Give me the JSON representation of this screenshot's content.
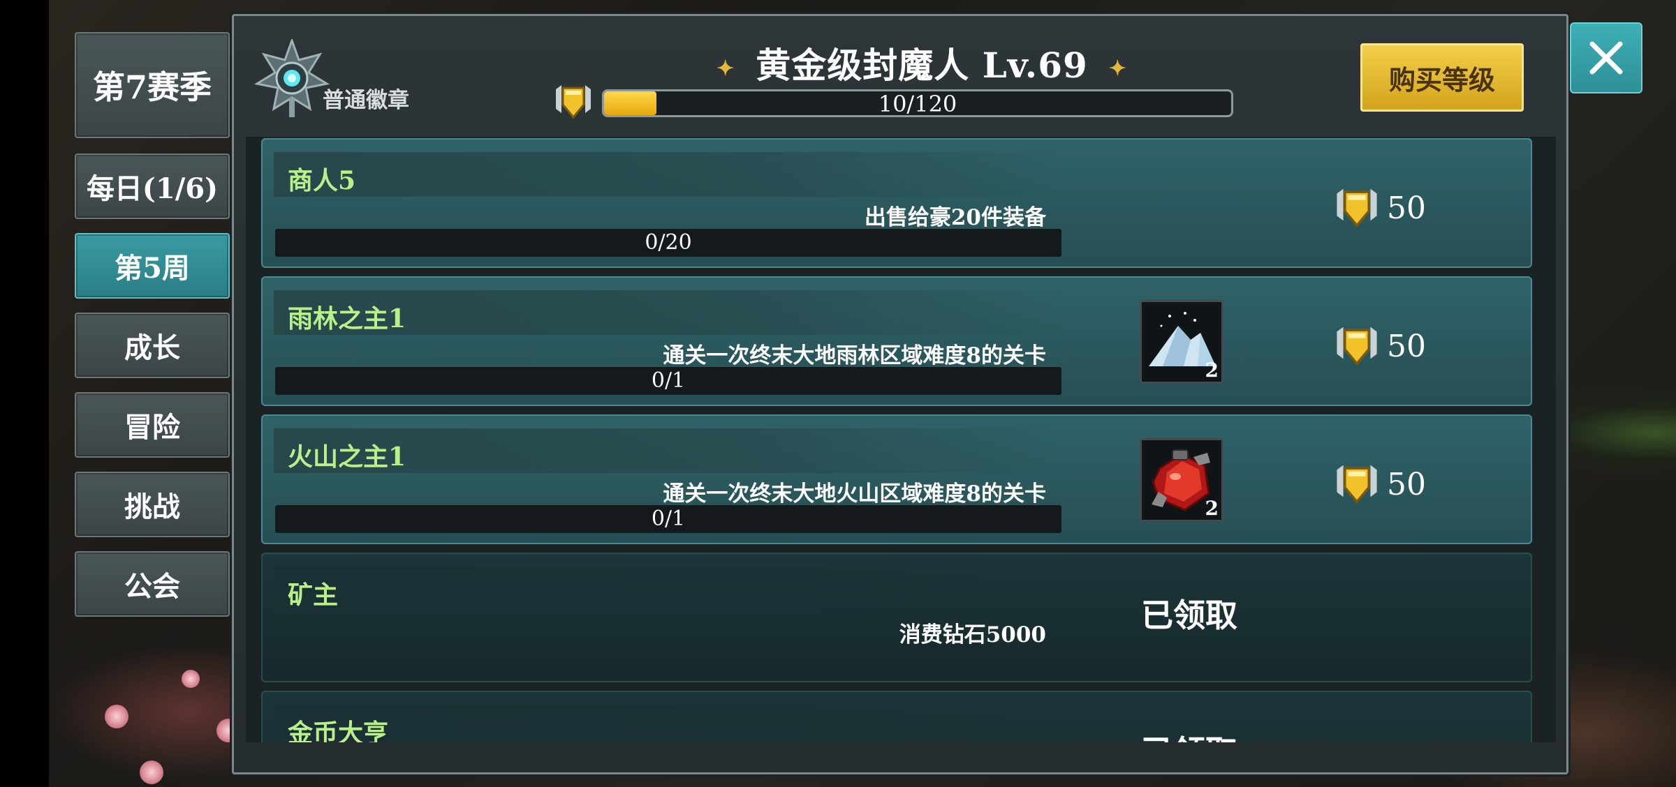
{
  "tabs": [
    {
      "label": "第7赛季",
      "active": false
    },
    {
      "label": "每日(1/6)",
      "active": false
    },
    {
      "label": "第5周",
      "active": true
    },
    {
      "label": "成长",
      "active": false
    },
    {
      "label": "冒险",
      "active": false
    },
    {
      "label": "挑战",
      "active": false
    },
    {
      "label": "公会",
      "active": false
    }
  ],
  "header": {
    "badge_label": "普通徽章",
    "level_title": "黄金级封魔人 Lv.69",
    "xp_text": "10/120",
    "xp_fraction": 0.083,
    "buy_label": "购买等级"
  },
  "tasks": [
    {
      "name": "商人5",
      "desc": "出售给豪20件装备",
      "progress": "0/20",
      "reward": "50",
      "item": null,
      "claimed": false
    },
    {
      "name": "雨林之主1",
      "desc": "通关一次终末大地雨林区域难度8的关卡",
      "progress": "0/1",
      "reward": "50",
      "item": {
        "icon": "crystal-pile-icon",
        "count": "2"
      },
      "claimed": false
    },
    {
      "name": "火山之主1",
      "desc": "通关一次终末大地火山区域难度8的关卡",
      "progress": "0/1",
      "reward": "50",
      "item": {
        "icon": "red-potion-icon",
        "count": "2"
      },
      "claimed": false
    },
    {
      "name": "矿主",
      "desc": "消费钻石5000",
      "claimed": true,
      "claimed_label": "已领取"
    },
    {
      "name": "金币大亨",
      "claimed": true,
      "claimed_label": "已领取"
    }
  ],
  "colors": {
    "accent_teal": "#2a7d86",
    "gold": "#e7a90c",
    "task_name_green": "#b9f08a"
  }
}
